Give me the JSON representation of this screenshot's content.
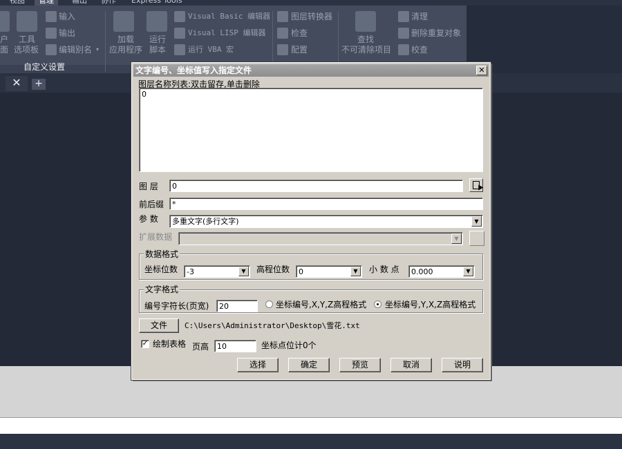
{
  "ribbon": {
    "tabs": [
      "视图",
      "管理",
      "输出",
      "协作",
      "Express Tools"
    ],
    "items": {
      "user_icon_label_1": "户",
      "user_icon_label_2": "面",
      "tool_palette_1": "工具",
      "tool_palette_2": "选项板",
      "import": "输入",
      "export": "输出",
      "edit_alias": "编辑别名",
      "load_app_1": "加载",
      "load_app_2": "应用程序",
      "run_script_1": "运行",
      "run_script_2": "脚本",
      "vb_editor": "Visual Basic 编辑器",
      "vlisp_editor": "Visual LISP 编辑器",
      "run_vba": "运行 VBA 宏",
      "layer_translator": "图层转换器",
      "check": "检查",
      "configure": "配置",
      "find_1": "查找",
      "find_2": "不可清除项目",
      "purge": "清理",
      "delete_duplicates": "删除重复对象",
      "verify": "校查"
    },
    "group_custom": "自定义设置"
  },
  "file_tabs": {
    "close_glyph": "✕",
    "add_glyph": "+"
  },
  "dialog": {
    "title": "文字编号、坐标值写入指定文件",
    "close_glyph": "✕",
    "layer_list_label": "图层名称列表:双击留存,单击删除",
    "layer_list_items": [
      "0"
    ],
    "layer_label": "图  层",
    "layer_value": "0",
    "affix_label": "前后缀",
    "affix_value": "*",
    "param_label": "参  数",
    "param_value": "多重文字(多行文字)",
    "ext_data_label": "扩展数据",
    "ext_data_value": "",
    "data_format": {
      "title": "数据格式",
      "coord_digits_label": "坐标位数",
      "coord_digits_value": "-3",
      "elev_digits_label": "高程位数",
      "elev_digits_value": "0",
      "decimal_label": "小 数 点",
      "decimal_value": "0.000"
    },
    "text_format": {
      "title": "文字格式",
      "width_label": "编号字符长(页宽)",
      "width_value": "20",
      "option1": "坐标编号,X,Y,Z高程格式",
      "option2": "坐标编号,Y,X,Z高程格式",
      "selected": 2
    },
    "file_button": "文件",
    "file_path": "C:\\Users\\Administrator\\Desktop\\雪花.txt",
    "draw_table_label": "绘制表格",
    "draw_table_checked": true,
    "page_height_label": "页高",
    "page_height_value": "10",
    "point_count": "坐标点位计0个",
    "buttons": {
      "select": "选择",
      "ok": "确定",
      "preview": "预览",
      "cancel": "取消",
      "help": "说明"
    }
  }
}
